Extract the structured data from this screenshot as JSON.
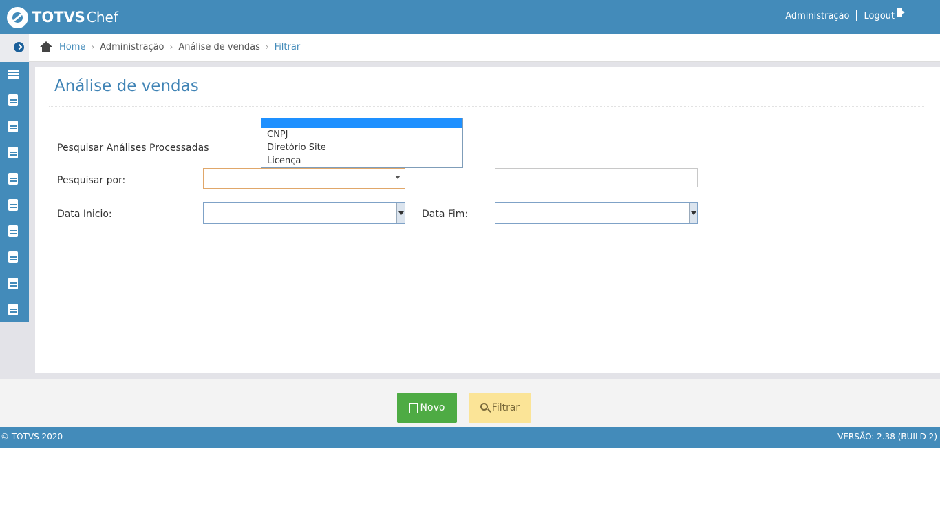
{
  "header": {
    "brand_main": "TOTVS",
    "brand_sub": "Chef",
    "admin_link": "Administração",
    "logout_link": "Logout"
  },
  "breadcrumb": {
    "items": [
      "Home",
      "Administração",
      "Análise de vendas",
      "Filtrar"
    ]
  },
  "page": {
    "title": "Análise de vendas"
  },
  "form": {
    "processed_label": "Pesquisar Análises Processadas",
    "search_by_label": "Pesquisar por:",
    "search_by_value": "",
    "search_text_value": "",
    "start_date_label": "Data Inicio:",
    "start_date_value": "",
    "end_date_label": "Data Fim:",
    "end_date_value": "",
    "dropdown_options": [
      "",
      "CNPJ",
      "Diretório Site",
      "Licença"
    ]
  },
  "actions": {
    "new_label": "Novo",
    "filter_label": "Filtrar"
  },
  "footer": {
    "copyright": "© TOTVS 2020",
    "version": "VERSÃO: 2.38 (BUILD 2)"
  },
  "colors": {
    "primary": "#438bba",
    "success": "#4eab44",
    "warning": "#fbe497",
    "highlight": "#1e90ff"
  }
}
